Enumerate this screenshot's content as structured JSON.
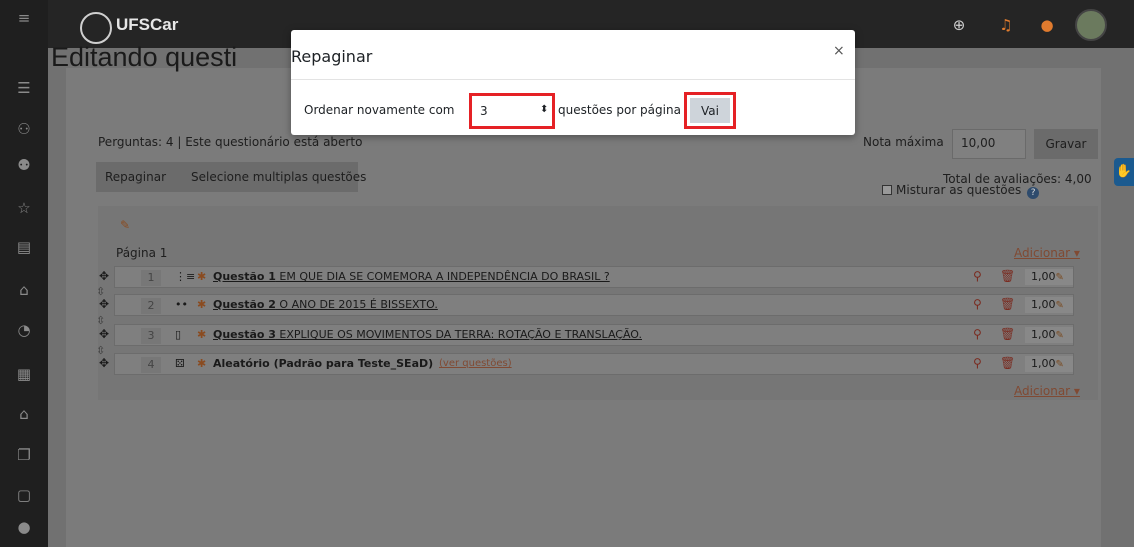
{
  "topbar": {
    "logo_text": "UFSCar",
    "icons": [
      "globe-icon",
      "bell-icon",
      "chat-icon"
    ]
  },
  "sidebar": {
    "icons": [
      "menu-icon",
      "list-icon",
      "people-icon",
      "group-icon",
      "star-icon",
      "book-icon",
      "home-icon",
      "dashboard-icon",
      "calendar-icon",
      "graduation-icon",
      "files-icon",
      "clipboard-icon",
      "accessibility-icon"
    ]
  },
  "page": {
    "title": "Editando questi",
    "subtitle": "Perguntas: 4 | Este questionário está aberto",
    "max_grade_label": "Nota máxima",
    "max_grade_value": "10,00",
    "save_label": "Gravar",
    "repaginate_label": "Repaginar",
    "select_multiple_label": "Selecione multiplas questões",
    "total_grades": "Total de avaliações: 4,00",
    "shuffle_label": "Misturar as questões",
    "page_label": "Página 1",
    "add_label": "Adicionar ▾"
  },
  "questions": [
    {
      "num": "1",
      "type_icon": "⋮≡",
      "title": "Questão 1",
      "text": " EM QUE DIA SE COMEMORA A INDEPENDÊNCIA DO BRASIL ?",
      "mark": "1,00"
    },
    {
      "num": "2",
      "type_icon": "••",
      "title": "Questão 2",
      "text": " O ANO DE 2015 É BISSEXTO.",
      "mark": "1,00"
    },
    {
      "num": "3",
      "type_icon": "▯",
      "title": "Questão 3",
      "text": " EXPLIQUE OS MOVIMENTOS DA TERRA: ROTAÇÃO E TRANSLAÇÃO.",
      "mark": "1,00"
    },
    {
      "num": "4",
      "type_icon": "⚄",
      "title": "Aleatório (Padrão para Teste_SEaD)",
      "text": "(ver questões)",
      "mark": "1,00"
    }
  ],
  "modal": {
    "title": "Repaginar",
    "close": "×",
    "label_before": "Ordenar novamente com",
    "select_value": "3",
    "label_after": "questões por página",
    "go_label": "Vai"
  },
  "colors": {
    "highlight": "#e52125",
    "accent_link": "#c2753f"
  }
}
